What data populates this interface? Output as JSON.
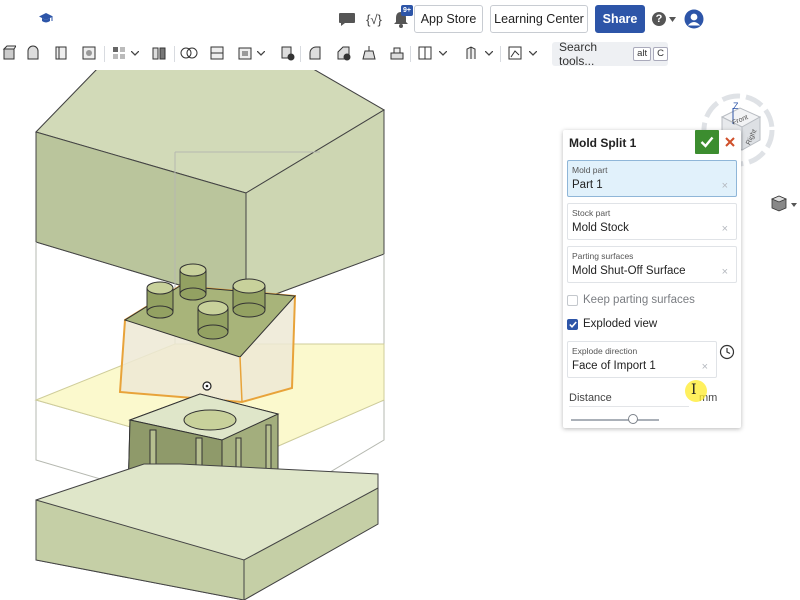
{
  "topbar": {
    "logo_icon": "graduation-cap-icon",
    "comment_icon": "comment-icon",
    "variables_icon": "variables-icon",
    "variables_label": "{√}",
    "notifications_icon": "notification-bell-icon",
    "notifications_count": "9+",
    "app_store_label": "App Store",
    "learning_center_label": "Learning Center",
    "share_label": "Share",
    "help_icon": "help-icon",
    "help_label": "?",
    "user_icon": "user-avatar-icon"
  },
  "toolbar": {
    "search_label": "Search tools...",
    "search_key1": "alt",
    "search_key2": "C"
  },
  "dialog": {
    "title": "Mold Split 1",
    "mold_part": {
      "label": "Mold part",
      "value": "Part 1"
    },
    "stock_part": {
      "label": "Stock part",
      "value": "Mold Stock"
    },
    "parting_surfaces": {
      "label": "Parting surfaces",
      "value": "Mold Shut-Off Surface"
    },
    "keep_parting_surfaces": {
      "label": "Keep parting surfaces",
      "checked": false
    },
    "exploded_view": {
      "label": "Exploded view",
      "checked": true
    },
    "explode_direction": {
      "label": "Explode direction",
      "value": "Face of Import 1"
    },
    "distance": {
      "label": "Distance",
      "unit": "mm",
      "slider_fraction": 0.7
    },
    "clear_symbol": "×"
  },
  "view_cube": {
    "axis_label": "Z",
    "top_face": "Front",
    "right_face": "Right"
  },
  "colors": {
    "share_button": "#2d55a8",
    "accept_button": "#3c8d2f",
    "cancel_x": "#d0502a",
    "mold_block": "#dfe6c9",
    "part_highlight": "#e8a33a",
    "parting_plane": "#fbf8c8"
  }
}
